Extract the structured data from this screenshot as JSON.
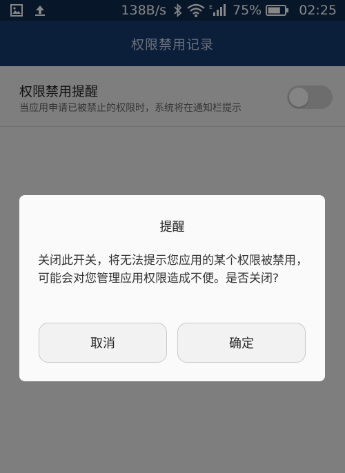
{
  "status_bar": {
    "net_speed": "138B/s",
    "battery_percent": "75%",
    "time": "02:25",
    "battery_level": 0.75,
    "icons": [
      "image-icon",
      "upload-icon",
      "bluetooth-icon",
      "wifi-icon",
      "signal-icon",
      "battery-icon"
    ]
  },
  "header": {
    "title": "权限禁用记录"
  },
  "setting": {
    "title": "权限禁用提醒",
    "description": "当应用申请已被禁止的权限时，系统将在通知栏提示",
    "toggle_on": false
  },
  "dialog": {
    "title": "提醒",
    "message": "关闭此开关，将无法提示您应用的某个权限被禁用，可能会对您管理应用权限造成不便。是否关闭?",
    "cancel_label": "取消",
    "confirm_label": "确定"
  },
  "colors": {
    "status_bar": "#0f2a4f",
    "header": "#163a6e",
    "scrim": "#000000"
  }
}
